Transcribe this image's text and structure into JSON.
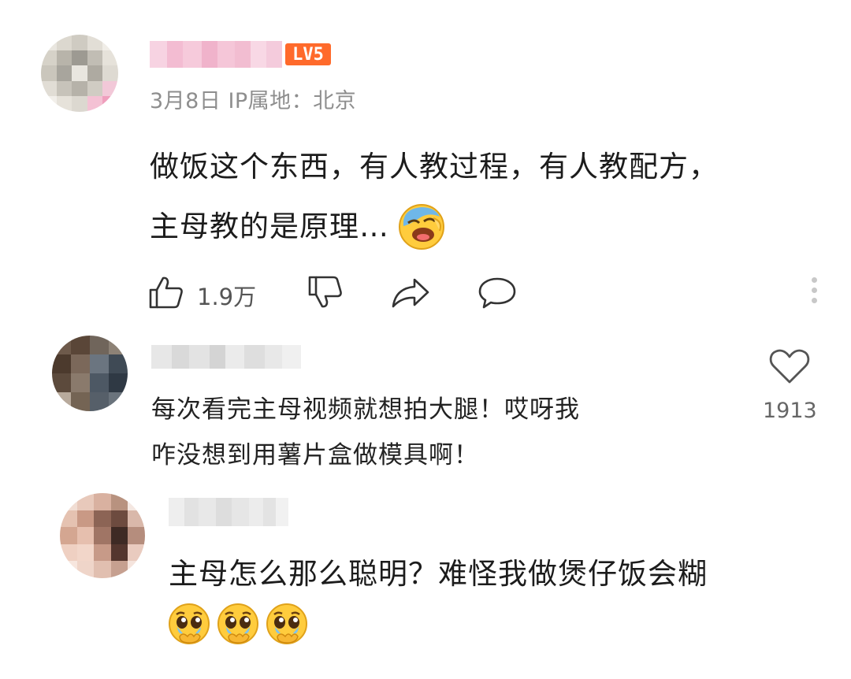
{
  "comment": {
    "level_badge": "LV5",
    "meta": "3月8日 IP属地：北京",
    "text_line1": "做饭这个东西，有人教过程，有人教配方，",
    "text_line2": "主母教的是原理…",
    "emoji": "laughing-crying-face",
    "like_count": "1.9万"
  },
  "reply1": {
    "text_line1": "每次看完主母视频就想拍大腿！哎呀我",
    "text_line2": "咋没想到用薯片盒做模具啊！",
    "like_count": "1913"
  },
  "reply2": {
    "text": "主母怎么那么聪明？难怪我做煲仔饭会糊",
    "emojis": [
      "pleading-face",
      "pleading-face",
      "pleading-face"
    ]
  },
  "colors": {
    "badge": "#ff6a2b",
    "meta_text": "#8e8e8e",
    "icon_stroke": "#333333"
  }
}
